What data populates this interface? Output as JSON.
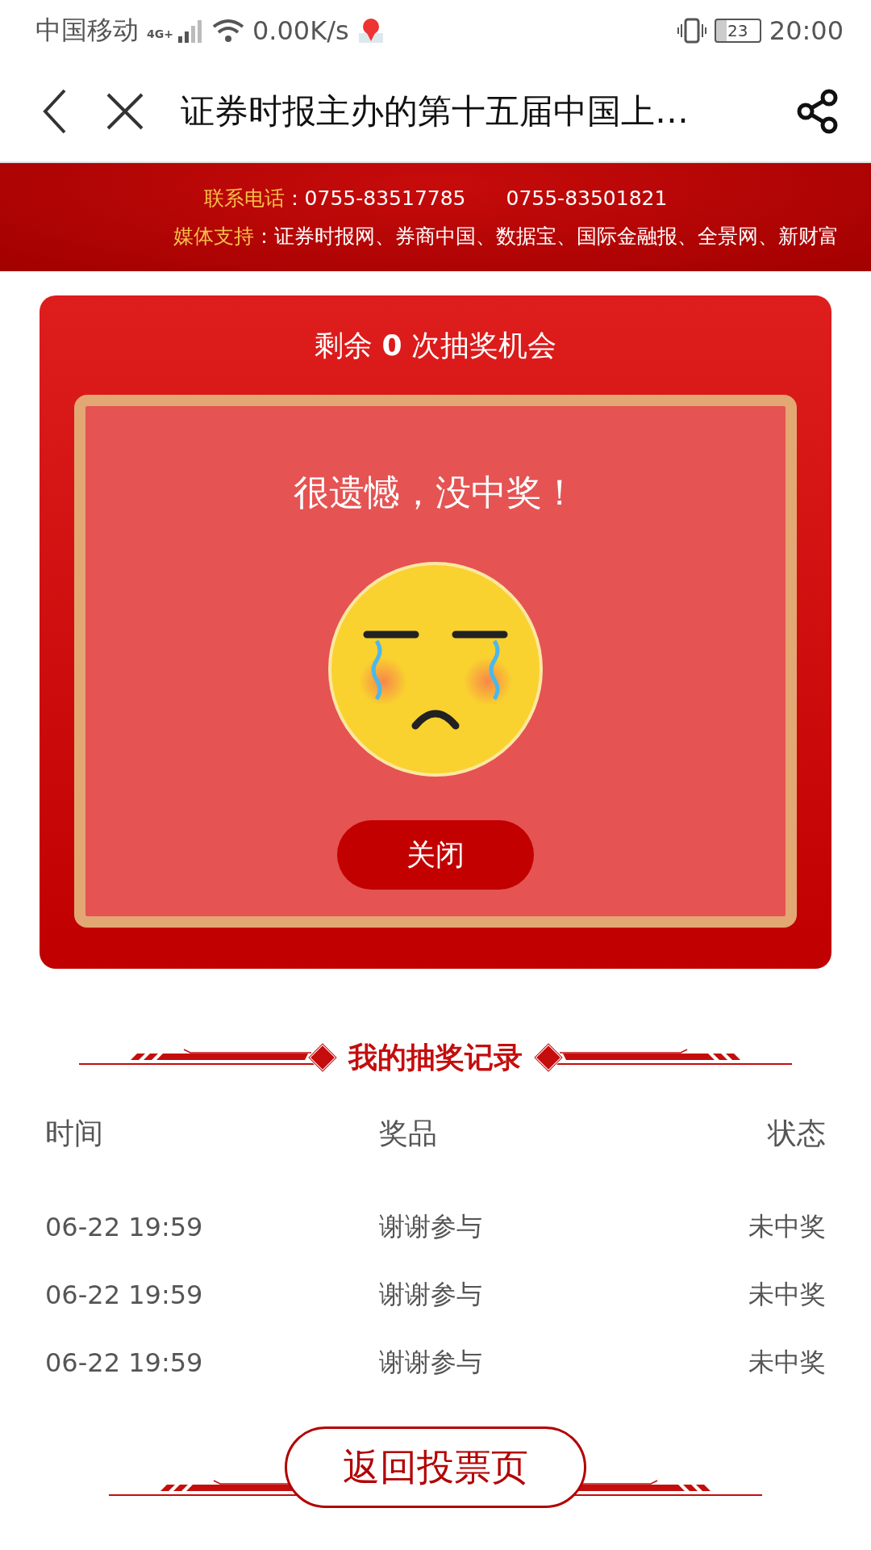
{
  "status_bar": {
    "carrier": "中国移动",
    "network": "4G+",
    "speed": "0.00K/s",
    "battery": "23",
    "time": "20:00"
  },
  "nav": {
    "title": "证券时报主办的第十五届中国上…"
  },
  "banner": [
    {
      "label": "联系电话",
      "text": "：0755-83517785　　0755-83501821"
    },
    {
      "label": "媒体支持",
      "text": "：证券时报网、券商中国、数据宝、国际金融报、全景网、新财富"
    }
  ],
  "lottery": {
    "remaining": "剩余 **0** 次抽奖机会",
    "result": "很遗憾，没中奖！",
    "close_button": "关闭"
  },
  "record": {
    "title": "我的抽奖记录",
    "columns": [
      "时间",
      "奖品",
      "状态"
    ],
    "rows": [
      [
        "06-22 19:59",
        "谢谢参与",
        "未中奖"
      ],
      [
        "06-22 19:59",
        "谢谢参与",
        "未中奖"
      ],
      [
        "06-22 19:59",
        "谢谢参与",
        "未中奖"
      ]
    ]
  },
  "back_button": "返回投票页"
}
